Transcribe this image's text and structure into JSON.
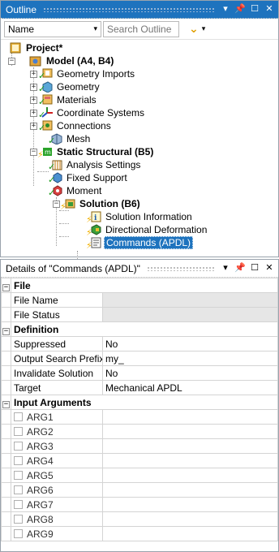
{
  "outline": {
    "title": "Outline",
    "name_select": "Name",
    "search_placeholder": "Search Outline",
    "tree": {
      "project": "Project*",
      "model": "Model (A4, B4)",
      "geometry_imports": "Geometry Imports",
      "geometry": "Geometry",
      "materials": "Materials",
      "coordinate_systems": "Coordinate Systems",
      "connections": "Connections",
      "mesh": "Mesh",
      "static_structural": "Static Structural (B5)",
      "analysis_settings": "Analysis Settings",
      "fixed_support": "Fixed Support",
      "moment": "Moment",
      "solution": "Solution (B6)",
      "solution_information": "Solution Information",
      "directional_deformation": "Directional Deformation",
      "commands_apdl": "Commands (APDL)"
    }
  },
  "details": {
    "title": "Details of \"Commands (APDL)\"",
    "sections": {
      "file": "File",
      "definition": "Definition",
      "input_arguments": "Input Arguments"
    },
    "file_rows": [
      {
        "key": "File Name",
        "value": ""
      },
      {
        "key": "File Status",
        "value": ""
      }
    ],
    "definition_rows": [
      {
        "key": "Suppressed",
        "value": "No"
      },
      {
        "key": "Output Search Prefix",
        "value": "my_"
      },
      {
        "key": "Invalidate Solution",
        "value": "No"
      },
      {
        "key": "Target",
        "value": "Mechanical APDL"
      }
    ],
    "args": [
      "ARG1",
      "ARG2",
      "ARG3",
      "ARG4",
      "ARG5",
      "ARG6",
      "ARG7",
      "ARG8",
      "ARG9"
    ]
  }
}
